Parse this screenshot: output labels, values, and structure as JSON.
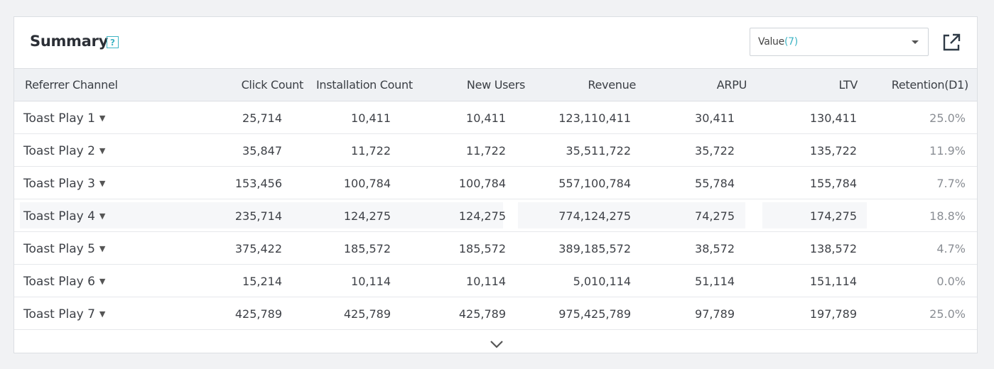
{
  "panel": {
    "title": "Summary",
    "help_glyph": "?",
    "select": {
      "label": "Value",
      "count": "(7)"
    },
    "export_icon": "external-link-icon"
  },
  "table": {
    "headers": [
      "Referrer Channel",
      "Click Count",
      "Installation Count",
      "New Users",
      "Revenue",
      "ARPU",
      "LTV",
      "Retention(D1)"
    ],
    "rows": [
      {
        "channel": "Toast Play 1",
        "clicks": "25,714",
        "installs": "10,411",
        "new_users": "10,411",
        "revenue": "123,110,411",
        "arpu": "30,411",
        "ltv": "130,411",
        "retention": "25.0%"
      },
      {
        "channel": "Toast Play 2",
        "clicks": "35,847",
        "installs": "11,722",
        "new_users": "11,722",
        "revenue": "35,511,722",
        "arpu": "35,722",
        "ltv": "135,722",
        "retention": "11.9%"
      },
      {
        "channel": "Toast Play 3",
        "clicks": "153,456",
        "installs": "100,784",
        "new_users": "100,784",
        "revenue": "557,100,784",
        "arpu": "55,784",
        "ltv": "155,784",
        "retention": "7.7%"
      },
      {
        "channel": "Toast Play 4",
        "clicks": "235,714",
        "installs": "124,275",
        "new_users": "124,275",
        "revenue": "774,124,275",
        "arpu": "74,275",
        "ltv": "174,275",
        "retention": "18.8%"
      },
      {
        "channel": "Toast Play 5",
        "clicks": "375,422",
        "installs": "185,572",
        "new_users": "185,572",
        "revenue": "389,185,572",
        "arpu": "38,572",
        "ltv": "138,572",
        "retention": "4.7%"
      },
      {
        "channel": "Toast Play 6",
        "clicks": "15,214",
        "installs": "10,114",
        "new_users": "10,114",
        "revenue": "5,010,114",
        "arpu": "51,114",
        "ltv": "151,114",
        "retention": "0.0%"
      },
      {
        "channel": "Toast Play 7",
        "clicks": "425,789",
        "installs": "425,789",
        "new_users": "425,789",
        "revenue": "975,425,789",
        "arpu": "97,789",
        "ltv": "197,789",
        "retention": "25.0%"
      }
    ],
    "expand_icon": "chevron-down-icon"
  },
  "colors": {
    "accent": "#3eb4c4",
    "header_bg": "#eff1f4",
    "border": "#dcdfe3"
  }
}
